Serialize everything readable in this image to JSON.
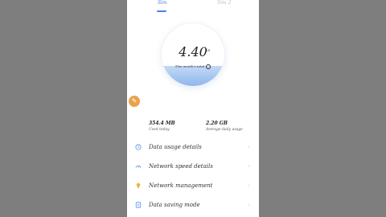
{
  "tabs": [
    {
      "label": "Sim"
    },
    {
      "label": "Sim 2"
    }
  ],
  "gauge": {
    "value": "4.40",
    "unit": "GB",
    "caption": "This month's total",
    "fill_fraction": 0.32
  },
  "floating_button": {
    "icon": "rocket-icon",
    "glyph": "✎",
    "color": "#e9a24c"
  },
  "stats": {
    "used_today": {
      "value": "354.4 MB",
      "label": "Used today"
    },
    "avg_daily": {
      "value": "2.20 GB",
      "label": "Average daily usage"
    }
  },
  "menu": {
    "items": [
      {
        "label": "Data usage details",
        "icon": "clock-icon"
      },
      {
        "label": "Network speed details",
        "icon": "speedometer-icon"
      },
      {
        "label": "Network management",
        "icon": "lightbulb-icon"
      },
      {
        "label": "Data saving mode",
        "icon": "data-saving-icon"
      }
    ],
    "chevron": "›"
  },
  "colors": {
    "accent": "#4a7fe8",
    "icon_blue": "#5a8ee8",
    "icon_amber": "#f0b63c",
    "background": "#7c7c7c"
  }
}
